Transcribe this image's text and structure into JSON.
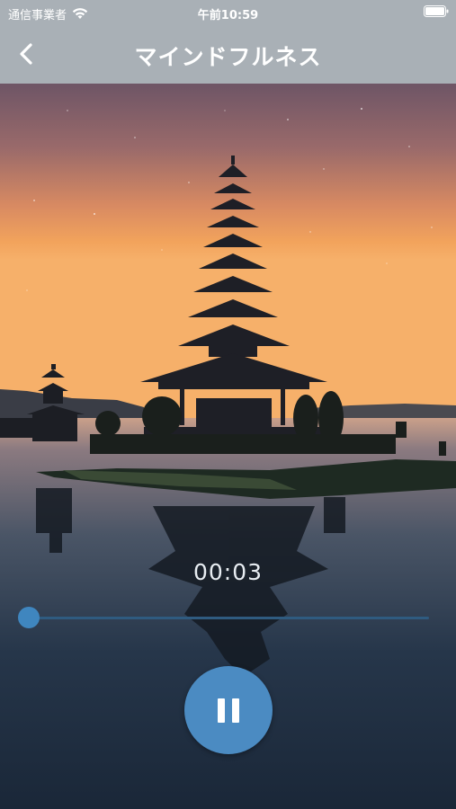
{
  "status_bar": {
    "carrier": "通信事業者",
    "time": "午前10:59",
    "wifi_icon": "wifi-icon",
    "battery_icon": "battery-icon"
  },
  "nav": {
    "title": "マインドフルネス",
    "back_icon": "chevron-left-icon"
  },
  "player": {
    "elapsed": "00:03",
    "progress_fraction": 0.0,
    "state": "playing",
    "control_icon": "pause-icon",
    "accent_color": "#4b8bc2"
  }
}
